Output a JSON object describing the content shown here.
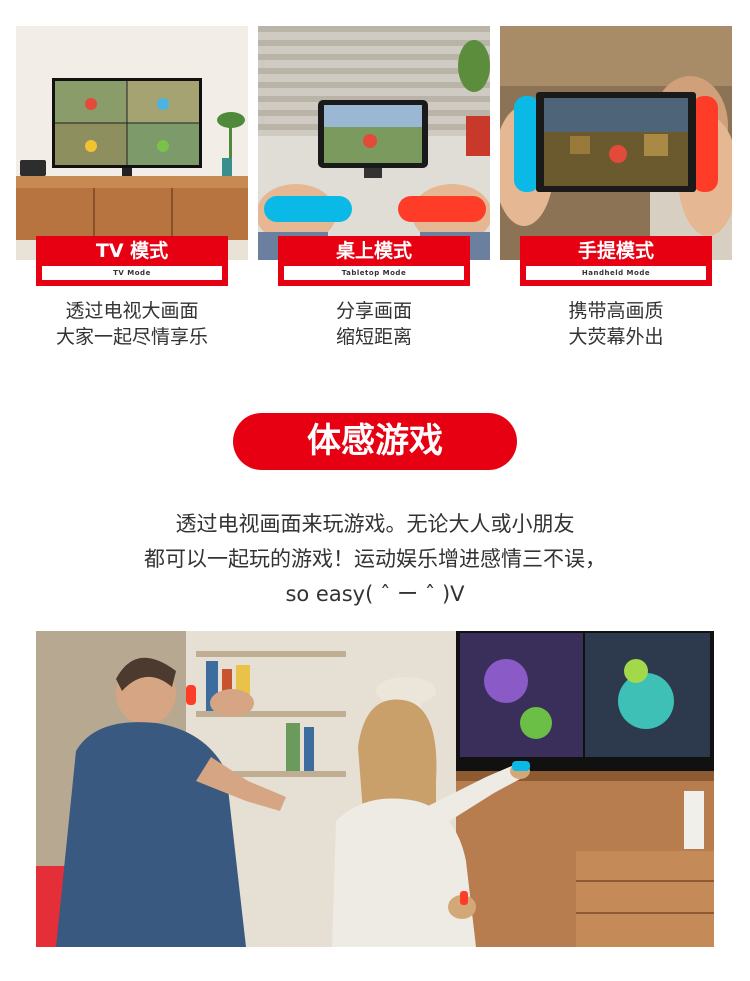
{
  "modes": [
    {
      "label_cn": "TV 模式",
      "label_en": "TV Mode",
      "desc_line1": "透过电视大画面",
      "desc_line2": "大家一起尽情享乐"
    },
    {
      "label_cn": "桌上模式",
      "label_en": "Tabletop Mode",
      "desc_line1": "分享画面",
      "desc_line2": "缩短距离"
    },
    {
      "label_cn": "手提模式",
      "label_en": "Handheld Mode",
      "desc_line1": "携带高画质",
      "desc_line2": "大荧幕外出"
    }
  ],
  "section": {
    "title": "体感游戏",
    "line1": "透过电视画面来玩游戏。无论大人或小朋友",
    "line2": "都可以一起玩的游戏！运动娱乐增进感情三不误，",
    "line3": "so easy( ˆ ー ˆ )V"
  },
  "colors": {
    "brand_red": "#e60012",
    "neon_blue": "#0ab9e6",
    "neon_red": "#ff3c28"
  }
}
